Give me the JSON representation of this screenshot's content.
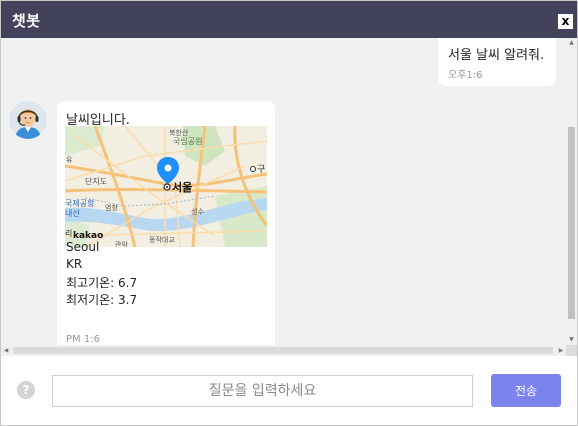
{
  "window": {
    "title": "챗봇",
    "close_label": "x"
  },
  "messages": {
    "user": {
      "text": "서울 날씨 알려줘.",
      "time": "오후1:6"
    },
    "bot": {
      "greeting": "날씨입니다.",
      "city": "Seoul",
      "country": "KR",
      "max_temp": "최고기온: 6.7",
      "min_temp": "최저기온: 3.7",
      "time": "PM 1:6"
    }
  },
  "map": {
    "marker_label": "서울",
    "logo": "kakao",
    "labels": {
      "park": "국립공원",
      "area_top": "북한산",
      "danjido": "단지도",
      "yeomchang": "염창",
      "airport_1": "국제공항",
      "airport_2": "내선",
      "yu": "유",
      "gu": "구",
      "seongsu": "성수",
      "dongjakdaegyo": "동작대교",
      "gwanak": "관악",
      "ri": "리"
    }
  },
  "input": {
    "placeholder": "질문을 입력하세요",
    "value": ""
  },
  "send_button": "전송",
  "help_icon": "?",
  "icons": {
    "close": "close-icon",
    "help": "question-circle-icon",
    "avatar": "support-agent-avatar",
    "map_pin": "map-pin-icon"
  },
  "colors": {
    "titlebar": "#42425a",
    "send_button": "#7b84ee",
    "map_pin": "#1f8fff",
    "chat_background": "#f1f1f1"
  }
}
